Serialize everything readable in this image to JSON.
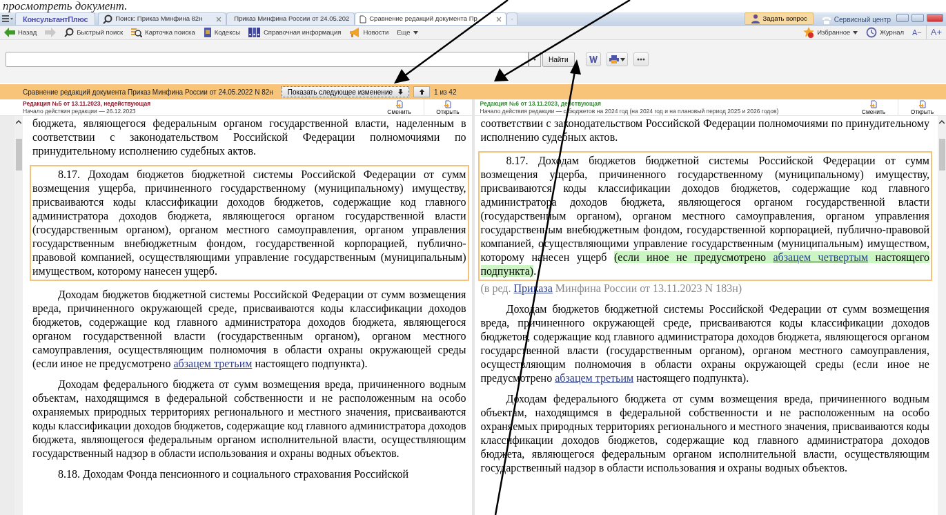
{
  "caption": "просмотреть документ.",
  "app": {
    "brand": "КонсультантПлюс",
    "tabs": [
      {
        "label": "Поиск: Приказ Минфина 82н",
        "kind": "search",
        "selected": false
      },
      {
        "label": "Приказ Минфина России от 24.05.202",
        "kind": "document",
        "selected": false
      },
      {
        "label": "Сравнение редакций документа Пр",
        "kind": "document",
        "selected": true
      }
    ],
    "ask_button": "Задать вопрос",
    "service_center": "Сервисный центр"
  },
  "toolbar": {
    "items": [
      {
        "label": "Назад",
        "kind": "back",
        "disabled": false
      },
      {
        "kind": "forward",
        "disabled": true
      },
      {
        "label": "Быстрый поиск",
        "kind": "search",
        "disabled": false
      },
      {
        "label": "Карточка поиска",
        "kind": "card",
        "disabled": false
      },
      {
        "label": "Кодексы",
        "kind": "book",
        "disabled": false
      },
      {
        "label": "Справочная информация",
        "kind": "binders",
        "disabled": false
      },
      {
        "label": "Новости",
        "kind": "megaphone",
        "disabled": false
      },
      {
        "label": "Еще",
        "kind": "more",
        "disabled": false
      }
    ],
    "right": [
      {
        "label": "Избранное",
        "kind": "star"
      },
      {
        "label": "Журнал",
        "kind": "history"
      }
    ],
    "font_smaller": "A−",
    "font_larger": "A+"
  },
  "search": {
    "button": "Найти"
  },
  "compare_bar": {
    "title": "Сравнение редакций документа Приказ Минфина России от 24.05.2022 N 82н",
    "next_button": "Показать следующее изменение",
    "counter": "1 из 42"
  },
  "panels": [
    {
      "title": "Редакция №5 от 13.11.2023,",
      "status": "недействующая",
      "kind": "inactive",
      "start": "Начало действия редакции — 26.12.2023",
      "buttons": [
        "Сменить",
        "Открыть"
      ],
      "paragraphs": [
        {
          "kind": "continuation",
          "changed": false,
          "segments": [
            {
              "kind": "plain",
              "text": "бюджета, являющегося федеральным органом государственной власти, наделенным в соответствии с законодательством Российской Федерации полномочиями по принудительному исполнению судебных актов."
            }
          ]
        },
        {
          "kind": "text",
          "changed": true,
          "segments": [
            {
              "kind": "plain",
              "text": "8.17. Доходам бюджетов бюджетной системы Российской Федерации от сумм возмещения ущерба, причиненного государственному (муниципальному) имуществу, присваиваются коды классификации доходов бюджетов, содержащие код главного администратора доходов бюджета, являющегося органом государственной власти (государственным органом), органом местного самоуправления, органом управления государственным внебюджетным фондом, государственной корпорацией, публично-правовой компанией, осуществляющими управление государственным (муниципальным) имуществом, которому нанесен ущерб."
            }
          ]
        },
        {
          "kind": "text",
          "changed": false,
          "segments": [
            {
              "kind": "plain",
              "text": "Доходам бюджетов бюджетной системы Российской Федерации от сумм возмещения вреда, причиненного окружающей среде, присваиваются коды классификации доходов бюджетов, содержащие код главного администратора доходов бюджета, являющегося органом государственной власти (государственным органом), органом местного самоуправления, осуществляющим полномочия в области охраны окружающей среды (если иное не предусмотрено "
            },
            {
              "kind": "link",
              "text": "абзацем третьим"
            },
            {
              "kind": "plain",
              "text": " настоящего подпункта)."
            }
          ]
        },
        {
          "kind": "text",
          "changed": false,
          "segments": [
            {
              "kind": "plain",
              "text": "Доходам федерального бюджета от сумм возмещения вреда, причиненного водным объектам, находящимся в федеральной собственности и не расположенным на особо охраняемых природных территориях регионального и местного значения, присваиваются коды классификации доходов бюджетов, содержащие код главного администратора доходов бюджета, являющегося федеральным органом исполнительной власти, осуществляющим государственный надзор в области использования и охраны водных объектов."
            }
          ]
        },
        {
          "kind": "text",
          "changed": false,
          "segments": [
            {
              "kind": "plain",
              "text": "8.18. Доходам Фонда пенсионного и социального страхования Российской"
            }
          ]
        }
      ]
    },
    {
      "title": "Редакция №6 от 13.11.2023,",
      "status": "действующая",
      "kind": "active",
      "start": "Начало действия редакции — с бюджетов на 2024 год (на 2024 год и на плановый период 2025 и 2026 годов)",
      "buttons": [
        "Сменить",
        "Открыть"
      ],
      "paragraphs": [
        {
          "kind": "continuation",
          "changed": false,
          "segments": [
            {
              "kind": "plain",
              "text": "соответствии с законодательством Российской Федерации полномочиями по принудительному исполнению судебных актов."
            }
          ]
        },
        {
          "kind": "text",
          "changed": true,
          "segments": [
            {
              "kind": "plain",
              "text": "8.17. Доходам бюджетов бюджетной системы Российской Федерации от сумм возмещения ущерба, причиненного государственному (муниципальному) имуществу, присваиваются коды классификации доходов бюджетов, содержащие код главного администратора доходов бюджета, являющегося органом государственной власти (государственным органом), органом местного самоуправления, органом управления государственным внебюджетным фондом, государственной корпорацией, публично-правовой компанией, осуществляющими управление государственным (муниципальным) имуществом, которому нанесен ущерб "
            },
            {
              "kind": "added",
              "text": "(если иное не предусмотрено "
            },
            {
              "kind": "added-link",
              "text": "абзацем четвертым"
            },
            {
              "kind": "added",
              "text": " настоящего подпункта)"
            },
            {
              "kind": "plain",
              "text": "."
            }
          ]
        },
        {
          "kind": "note",
          "changed": false,
          "segments": [
            {
              "kind": "plain",
              "text": "(в ред. "
            },
            {
              "kind": "link",
              "text": "Приказа"
            },
            {
              "kind": "plain",
              "text": " Минфина России от 13.11.2023 N 183н)"
            }
          ]
        },
        {
          "kind": "text",
          "changed": false,
          "segments": [
            {
              "kind": "plain",
              "text": "Доходам бюджетов бюджетной системы Российской Федерации от сумм возмещения вреда, причиненного окружающей среде, присваиваются коды классификации доходов бюджетов, содержащие код главного администратора доходов бюджета, являющегося органом государственной власти (государственным органом), органом местного самоуправления, осуществляющим полномочия в области охраны окружающей среды (если иное не предусмотрено "
            },
            {
              "kind": "link",
              "text": "абзацем третьим"
            },
            {
              "kind": "plain",
              "text": " настоящего подпункта)."
            }
          ]
        },
        {
          "kind": "text",
          "changed": false,
          "segments": [
            {
              "kind": "plain",
              "text": "Доходам федерального бюджета от сумм возмещения вреда, причиненного водным объектам, находящимся в федеральной собственности и не расположенным на особо охраняемых природных территориях регионального и местного значения, присваиваются коды классификации доходов бюджетов, содержащие код главного администратора доходов бюджета, являющегося федеральным органом исполнительной власти, осуществляющим государственный надзор в области использования и охраны водных объектов."
            }
          ]
        }
      ]
    }
  ]
}
